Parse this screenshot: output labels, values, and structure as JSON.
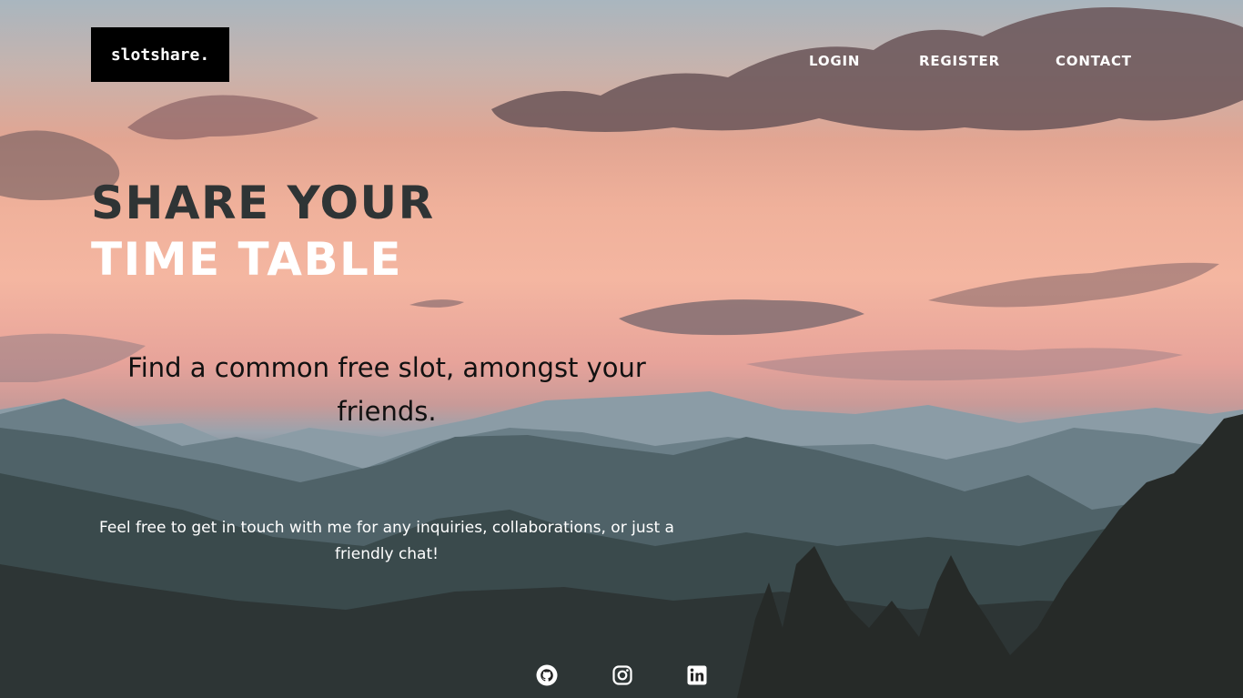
{
  "brand": {
    "logo_text": "slotshare."
  },
  "nav": {
    "login": "LOGIN",
    "register": "REGISTER",
    "contact": "CONTACT"
  },
  "hero": {
    "headline_line1": "SHARE YOUR",
    "headline_line2": "TIME TABLE",
    "tagline": "Find a common free slot, amongst your friends.",
    "contact_text": "Feel free to get in touch with me for any inquiries, collaborations, or just a friendly chat!"
  },
  "socials": [
    "github-icon",
    "instagram-icon",
    "linkedin-icon"
  ],
  "colors": {
    "logo_bg": "#000000",
    "headline_dark": "#2f3435",
    "headline_light": "#ffffff",
    "tagline": "#111111",
    "nav_text": "#ffffff"
  }
}
